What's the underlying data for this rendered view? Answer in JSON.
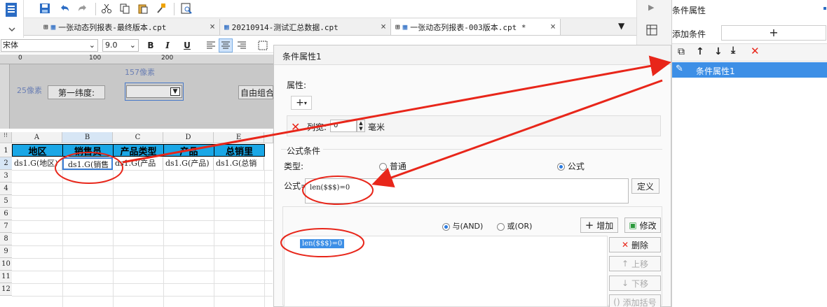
{
  "tabs": [
    {
      "label": "一张动态列报表-最终版本.cpt",
      "active": false
    },
    {
      "label": "20210914-测试汇总数据.cpt",
      "active": false
    },
    {
      "label": "一张动态列报表-003版本.cpt *",
      "active": true
    }
  ],
  "format_bar": {
    "font_family": "宋体",
    "font_size": "9.0",
    "bold": "B",
    "italic": "I",
    "underline": "U"
  },
  "ruler": {
    "mark_0": "0",
    "mark_100": "100",
    "mark_200": "200"
  },
  "param_pane": {
    "width_label": "157像素",
    "height_label": "25像素",
    "label_text": "第一纬度:",
    "combo_button": "自由组合"
  },
  "grid": {
    "columns": [
      "A",
      "B",
      "C",
      "D",
      "E"
    ],
    "rows": [
      "1",
      "2",
      "3",
      "4",
      "5",
      "6",
      "7",
      "8",
      "9",
      "10",
      "11",
      "12"
    ],
    "header_row": [
      "地区",
      "销售员",
      "产品类型",
      "产品",
      "总销里"
    ],
    "data_row": [
      "ds1.G(地区)",
      "ds1.G(销售",
      "ds1.G(产品",
      "ds1.G(产品)",
      "ds1.G(总销"
    ]
  },
  "dialog": {
    "title": "条件属性1",
    "attr_label": "属性:",
    "col_width_label": "列宽:",
    "col_width_value": "0",
    "col_width_unit": "毫米",
    "formula_condition_label": "公式条件",
    "type_label": "类型:",
    "type_normal": "普通",
    "type_formula": "公式",
    "formula_label": "公式=",
    "formula_value": "len($$$)=0",
    "define_button": "定义",
    "and_label": "与(AND)",
    "or_label": "或(OR)",
    "add_button": "增加",
    "modify_button": "修改",
    "list_item": "len($$$)=0",
    "delete_button": "删除",
    "up_button": "上移",
    "down_button": "下移",
    "add_paren_button": "添加括号"
  },
  "right_panel": {
    "title": "条件属性",
    "add_condition_label": "添加条件",
    "add_symbol": "+",
    "items": [
      "条件属性1"
    ]
  },
  "colors": {
    "header_blue": "#1aa7e6",
    "selection_blue": "#3d8fe6",
    "annotation_red": "#e8261a"
  }
}
